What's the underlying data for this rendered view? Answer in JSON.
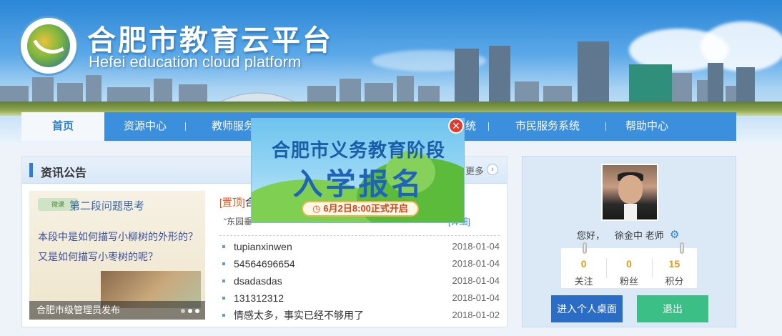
{
  "header": {
    "title": "合肥市教育云平台",
    "subtitle": "Hefei education cloud platform",
    "logo_icon": "school-emblem-icon"
  },
  "nav": {
    "items": [
      {
        "label": "首页",
        "active": true
      },
      {
        "label": "资源中心",
        "active": false
      },
      {
        "label": "教师服务",
        "active": false
      },
      {
        "label": "服务系统",
        "active": false
      },
      {
        "label": "市民服务系统",
        "active": false
      },
      {
        "label": "帮助中心",
        "active": false
      }
    ]
  },
  "news": {
    "title": "资讯公告",
    "more_label": "更多",
    "slide": {
      "logo_text": "微课",
      "heading": "第二段问题思考",
      "body": "本段中是如何描写小柳树的外形的？又是如何描写小枣树的呢？",
      "caption": "合肥市级管理员发布"
    },
    "pinned": {
      "tag": "[置顶]",
      "title": "合",
      "desc": "“东园垂",
      "link": "[详细]"
    },
    "items": [
      {
        "title": "tupianxinwen",
        "date": "2018-01-04"
      },
      {
        "title": "54564696654",
        "date": "2018-01-04"
      },
      {
        "title": "dsadasdas",
        "date": "2018-01-04"
      },
      {
        "title": "131312312",
        "date": "2018-01-04"
      },
      {
        "title": "情感太多，事实已经不够用了",
        "date": "2018-01-02"
      }
    ]
  },
  "user": {
    "greeting": "您好，",
    "name": "徐金中",
    "role": "老师",
    "stats": [
      {
        "value": "0",
        "label": "关注"
      },
      {
        "value": "0",
        "label": "粉丝"
      },
      {
        "value": "15",
        "label": "积分"
      }
    ],
    "desk_button": "进入个人桌面",
    "logout_button": "退出"
  },
  "popup": {
    "title": "合肥市义务教育阶段",
    "headline": "入学报名",
    "badge": "6月2日8:00正式开启"
  }
}
